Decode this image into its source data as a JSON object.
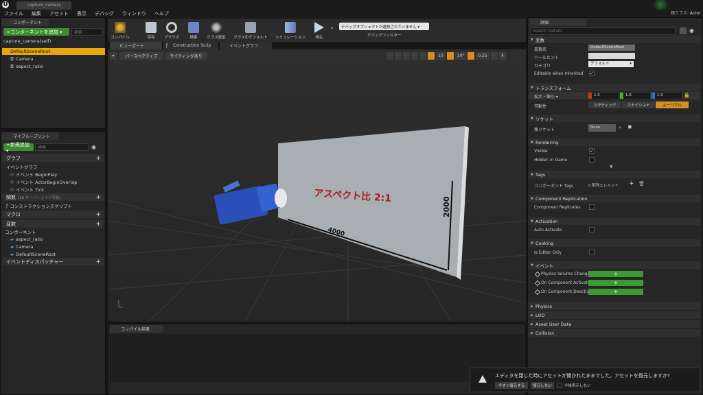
{
  "window": {
    "tab_title": "capture_camera"
  },
  "menu": [
    "ファイル",
    "編集",
    "アセット",
    "表示",
    "デバッグ",
    "ウィンドウ",
    "ヘルプ"
  ],
  "top_right": {
    "parent_label": "親クラス:",
    "parent_value": "Actor"
  },
  "components_panel": {
    "tab": "コンポーネント",
    "add_button": "+コンポーネントを追加 ▾",
    "search_placeholder": "検索",
    "self_item": "capture_camera(self)",
    "root_item": "DefaultSceneRoot",
    "children": [
      "Camera",
      "aspect_ratio"
    ]
  },
  "blueprint_panel": {
    "tab": "マイブループリント",
    "add_button": "+新規追加 ▾",
    "search_placeholder": "検索",
    "graph_section": "グラフ",
    "event_graph": "イベントグラフ",
    "events": [
      "イベント BeginPlay",
      "イベント ActorBeginOverlap",
      "イベント Tick"
    ],
    "functions_section": "関数",
    "functions_note": "(18 オーバーライド可能)",
    "construction_script": "コンストラクションスクリプト",
    "macros_section": "マクロ",
    "variables_section": "変数",
    "components_sub": "コンポーネント",
    "component_vars": [
      "aspect_ratio",
      "Camera",
      "DefaultSceneRoot"
    ],
    "dispatchers_section": "イベントディスパッチャー"
  },
  "toolbar": {
    "buttons": [
      "コンパイル",
      "保存",
      "ブラウズ",
      "検索",
      "クラス設定",
      "クラスのデフォルト",
      "シミュレーション",
      "再生"
    ],
    "debug_select": "デバッグオブジェクトが選択されていません ▾",
    "debug_filter": "デバッグフィルター"
  },
  "viewport": {
    "tabs": [
      "ビューポート",
      "Construction Scrip",
      "イベントグラフ"
    ],
    "perspective_btn": "パースペクティブ",
    "lighting_btn": "ライティングあり",
    "grid_snap": "10",
    "rot_snap": "10°",
    "scale_snap": "0.25",
    "cam_speed": "4",
    "plane_text": "アスペクト比 2:1",
    "width_label": "4000",
    "height_label": "2000"
  },
  "compile_panel": {
    "tab": "コンパイル結果"
  },
  "notification": {
    "message": "エディタを閉じた時にアセットが開かれたままでした。アセットを復元しますか?",
    "restore_now": "今すぐ復元する",
    "no_restore": "復元しない",
    "dont_show": "今後表示しない"
  },
  "details": {
    "tab": "詳細",
    "search_placeholder": "Search Details",
    "sections": {
      "variables": "変数",
      "transform": "トランスフォーム",
      "sockets": "ソケット",
      "rendering": "Rendering",
      "tags": "Tags",
      "component_replication": "Component Replication",
      "activation": "Activation",
      "cooking": "Cooking",
      "events": "イベント",
      "physics": "Physics",
      "lod": "LOD",
      "asset_user_data": "Asset User Data",
      "collision": "Collision"
    },
    "var_name_label": "変数名",
    "var_name_value": "DefaultSceneRoot",
    "tooltip_label": "ツールヒント",
    "category_label": "カテゴリ",
    "category_value": "デフォルト",
    "editable_label": "Editable when Inherited",
    "scale_label": "拡大・縮小 ▾",
    "scale_x": "1.0",
    "scale_y": "1.0",
    "scale_z": "1.0",
    "mobility_label": "可動性",
    "mobility": [
      "スタティック",
      "ステイショナ",
      "ムーバブル"
    ],
    "parent_socket_label": "親ソケット",
    "parent_socket_value": "None",
    "visible_label": "Visible",
    "hidden_label": "Hidden in Game",
    "component_tags_label": "コンポーネント Tags",
    "component_tags_value": "0 配列エレメント",
    "replicates_label": "Component Replicates",
    "auto_activate_label": "Auto Activate",
    "is_editor_only_label": "Is Editor Only",
    "event_items": [
      "Physics Volume Change",
      "On Component Activated",
      "On Component Deactiva"
    ]
  }
}
